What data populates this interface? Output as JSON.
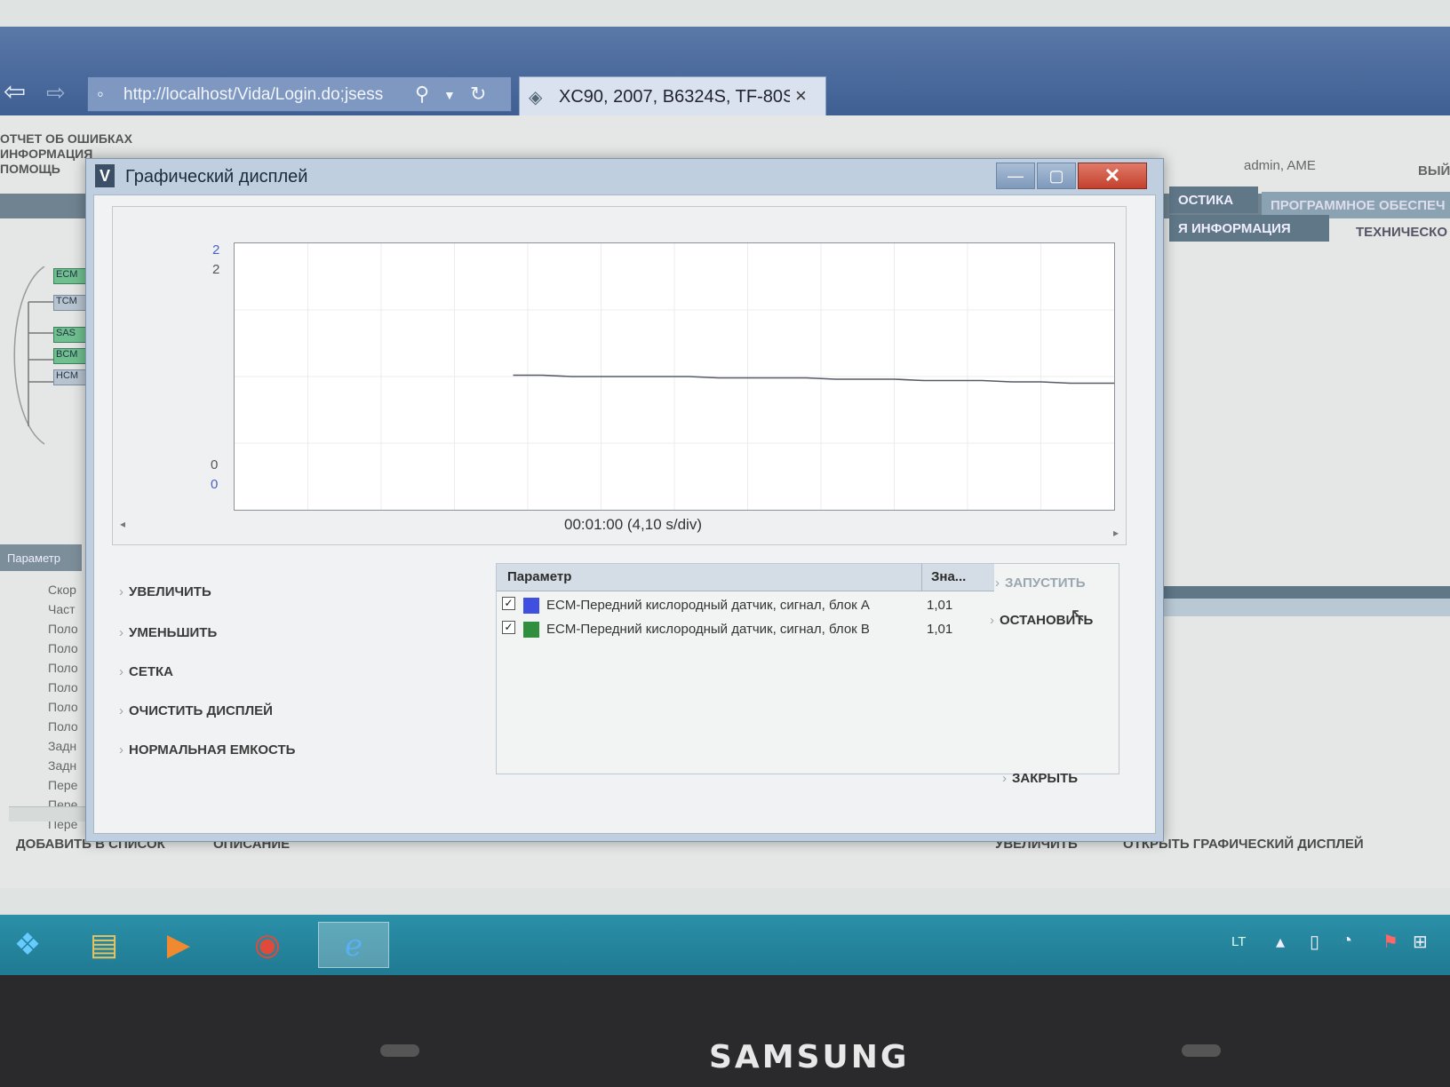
{
  "browser": {
    "back_icon": "back-arrow-icon",
    "address": "http://localhost/Vida/Login.do;jsess",
    "tab_title": "XC90, 2007, B6324S, TF-80S...",
    "tab_close": "×"
  },
  "background_app": {
    "menu": [
      "ОТЧЕТ ОБ ОШИБКАХ",
      "ИНФОРМАЦИЯ",
      "ПОМОЩЬ"
    ],
    "user": "admin, AME",
    "exit": "ВЫЙ",
    "tabs": [
      "ОСТИКА",
      "ПРОГРАММНОЕ ОБЕСПЕЧ"
    ],
    "subtabs": [
      "Я ИНФОРМАЦИЯ",
      "ТЕХНИЧЕСКО"
    ],
    "tree_nodes": [
      "ECM",
      "TCM",
      "SAS",
      "BCM",
      "HCM"
    ],
    "param_header": "Параметр",
    "param_items": [
      "Скор",
      "Част",
      "Поло",
      "Поло",
      "Поло",
      "Поло",
      "Поло",
      "Поло",
      "Задн",
      "Задн",
      "Пере",
      "Пере",
      "Пере"
    ],
    "bottom_left": [
      "ДОБАВИТЬ В СПИСОК",
      "ОПИСАНИЕ"
    ],
    "bottom_right": [
      "УВЕЛИЧИТЬ",
      "ОТКРЫТЬ ГРАФИЧЕСКИЙ ДИСПЛЕЙ"
    ]
  },
  "dialog": {
    "title": "Графический дисплей",
    "window_buttons": {
      "minimize": "—",
      "maximize": "▢",
      "close": "✕"
    },
    "chart": {
      "y_top_1": "2",
      "y_top_2": "2",
      "y_bottom_1": "0",
      "y_bottom_2": "0",
      "time_label": "00:01:00 (4,10 s/div)"
    },
    "side_buttons": [
      "УВЕЛИЧИТЬ",
      "УМЕНЬШИТЬ",
      "СЕТКА",
      "ОЧИСТИТЬ ДИСПЛЕЙ",
      "НОРМАЛЬНАЯ ЕМКОСТЬ"
    ],
    "table": {
      "col_param": "Параметр",
      "col_value": "Зна...",
      "rows": [
        {
          "name": "ECM-Передний кислородный датчик, сигнал, блок A",
          "value": "1,01",
          "checked": "✓",
          "color": "#3f4fe0"
        },
        {
          "name": "ECM-Передний кислородный датчик, сигнал, блок B",
          "value": "1,01",
          "checked": "✓",
          "color": "#2f8f3f"
        }
      ]
    },
    "start_label": "ЗАПУСТИТЬ",
    "stop_label": "ОСТАНОВИТЬ",
    "close_label": "ЗАКРЫТЬ"
  },
  "chart_data": {
    "type": "line",
    "ylim": [
      0,
      2
    ],
    "x": [
      0,
      2,
      4,
      6,
      8,
      10,
      12,
      14,
      16,
      18,
      20,
      22,
      24,
      26,
      28,
      30,
      32,
      34,
      36,
      38,
      40,
      41
    ],
    "series": [
      {
        "values": [
          1.01,
          1.01,
          1.0,
          1.0,
          1.0,
          1.0,
          1.0,
          0.99,
          0.99,
          0.99,
          0.99,
          0.98,
          0.98,
          0.98,
          0.97,
          0.97,
          0.97,
          0.96,
          0.96,
          0.95,
          0.95,
          0.95
        ]
      }
    ],
    "xlabel": "00:01:00 (4,10 s/div)",
    "grid": true
  },
  "taskbar": {
    "icons": [
      "windows-start-icon",
      "file-explorer-icon",
      "media-player-icon",
      "chrome-icon",
      "internet-explorer-icon"
    ],
    "lang": "LT"
  },
  "bezel": {
    "brand": "SAMSUNG"
  }
}
